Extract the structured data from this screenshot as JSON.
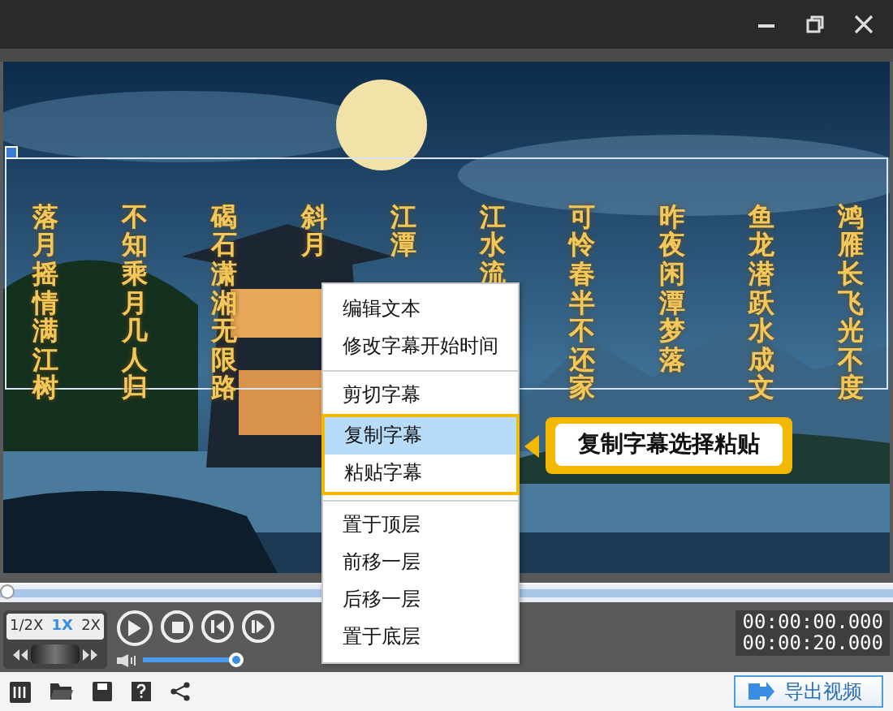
{
  "subtitle_columns": [
    "落月摇情满江树",
    "不知乘月几人归",
    "碣石潇湘无限路",
    "斜月",
    "江潭",
    "江水流",
    "可怜春半不还家",
    "昨夜闲潭梦落",
    "鱼龙潜跃水成文",
    "鸿雁长飞光不度"
  ],
  "context_menu": {
    "groups": [
      {
        "items": [
          {
            "label": "编辑文本",
            "selected": false,
            "annotated": false
          },
          {
            "label": "修改字幕开始时间",
            "selected": false,
            "annotated": false
          }
        ]
      },
      {
        "items": [
          {
            "label": "剪切字幕",
            "selected": false,
            "annotated": false
          },
          {
            "label": "复制字幕",
            "selected": true,
            "annotated": true
          },
          {
            "label": "粘贴字幕",
            "selected": false,
            "annotated": true
          }
        ]
      },
      {
        "items": [
          {
            "label": "置于顶层",
            "selected": false,
            "annotated": false
          },
          {
            "label": "前移一层",
            "selected": false,
            "annotated": false
          },
          {
            "label": "后移一层",
            "selected": false,
            "annotated": false
          },
          {
            "label": "置于底层",
            "selected": false,
            "annotated": false
          }
        ]
      }
    ]
  },
  "callout": {
    "text": "复制字幕选择粘贴"
  },
  "timeline": {
    "level": 0
  },
  "speeds": [
    {
      "label": "1/2X",
      "selected": false
    },
    {
      "label": "1X",
      "selected": true
    },
    {
      "label": "2X",
      "selected": false
    }
  ],
  "volume": {
    "level": 1
  },
  "times": {
    "current": "00:00:00.000",
    "total": "00:00:20.000"
  },
  "export_button": {
    "label": "导出视频"
  }
}
